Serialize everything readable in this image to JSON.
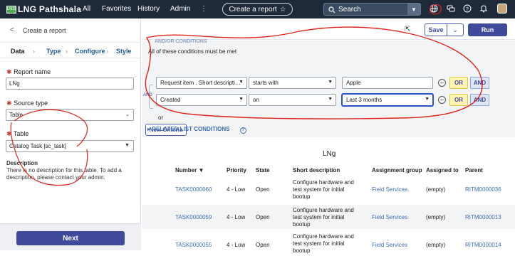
{
  "topbar": {
    "logo_mark": "LNG",
    "logo_text": "LNG Pathshala",
    "nav": [
      "All",
      "Favorites",
      "History",
      "Admin"
    ],
    "more_icon": "⋮",
    "create_report": "Create a report",
    "search_placeholder": "Search"
  },
  "left": {
    "back_title": "Create a report",
    "steps": [
      "Data",
      "Type",
      "Configure",
      "Style"
    ],
    "report_name_label": "Report name",
    "report_name_value": "LNg",
    "source_type_label": "Source type",
    "source_type_value": "Table",
    "table_label": "Table",
    "table_value": "Catalog Task [sc_task]",
    "desc_title": "Description",
    "desc_text": "There is no description for this table. To add a description, please contact your admin.",
    "next_label": "Next"
  },
  "toolbar": {
    "save_label": "Save",
    "run_label": "Run"
  },
  "conditions": {
    "header_text": "AND/OR CONDITIONS",
    "must_be": "All of these conditions must be met",
    "and_tag": "AND",
    "row1": {
      "field": "Request item . Short descripti…",
      "op": "starts with",
      "value": "Apple"
    },
    "row2": {
      "field": "Created",
      "op": "on",
      "value": "Last 3 months"
    },
    "or_label": "OR",
    "and_label": "AND",
    "or_text": "or",
    "new_criteria": "New Criteria",
    "related": "RELATED LIST CONDITIONS"
  },
  "table": {
    "title": "LNg",
    "headers": [
      "Number ▼",
      "Priority",
      "State",
      "Short description",
      "Assignment group",
      "Assigned to",
      "Parent"
    ],
    "rows": [
      {
        "number": "TASK0000060",
        "priority": "4 - Low",
        "state": "Open",
        "desc1": "Configure hardware and",
        "desc2": "test system for initial",
        "desc3": "bootup",
        "group": "Field Services",
        "assigned": "(empty)",
        "parent": "RITM0000036"
      },
      {
        "number": "TASK0000059",
        "priority": "4 - Low",
        "state": "Open",
        "desc1": "Configure hardware and",
        "desc2": "test system for initial",
        "desc3": "bootup",
        "group": "Field Services",
        "assigned": "(empty)",
        "parent": "RITM0000013"
      },
      {
        "number": "TASK0000055",
        "priority": "4 - Low",
        "state": "Open",
        "desc1": "Configure hardware and",
        "desc2": "test system for initial",
        "desc3": "bootup",
        "group": "Field Services",
        "assigned": "(empty)",
        "parent": "RITM0000014"
      }
    ]
  },
  "colors": {
    "topbar": "#1e2a3a",
    "primary": "#3f4a9a",
    "link": "#3f6fb0",
    "annotation": "#e0241b"
  }
}
